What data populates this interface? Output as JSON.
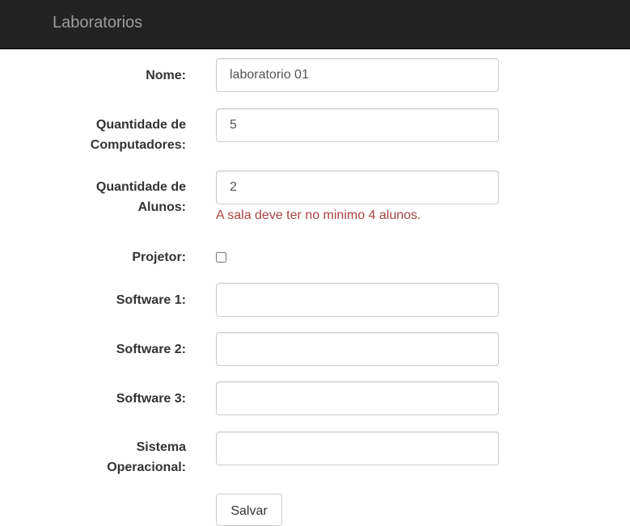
{
  "navbar": {
    "brand": "Laboratorios"
  },
  "form": {
    "nome": {
      "label": "Nome:",
      "value": "laboratorio 01"
    },
    "computadores": {
      "label_line1": "Quantidade de",
      "label_line2": "Computadores:",
      "value": "5"
    },
    "alunos": {
      "label_line1": "Quantidade de",
      "label_line2": "Alunos:",
      "value": "2",
      "error": "A sala deve ter no minimo 4 alunos."
    },
    "projetor": {
      "label": "Projetor:",
      "checked": false
    },
    "software1": {
      "label": "Software 1:",
      "value": ""
    },
    "software2": {
      "label": "Software 2:",
      "value": ""
    },
    "software3": {
      "label": "Software 3:",
      "value": ""
    },
    "sistema": {
      "label_line1": "Sistema",
      "label_line2": "Operacional:",
      "value": ""
    },
    "submit_label": "Salvar"
  },
  "colors": {
    "navbar_bg": "#222222",
    "brand": "#9d9d9d",
    "error": "#a94442",
    "border": "#cccccc"
  }
}
